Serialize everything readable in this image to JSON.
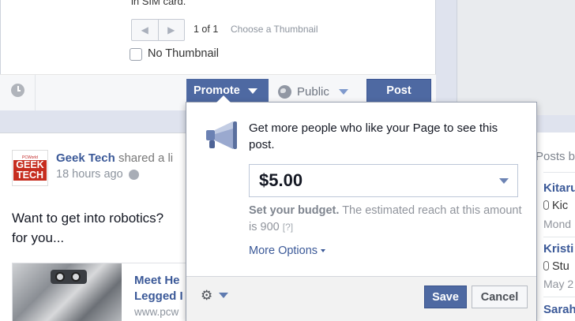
{
  "composer": {
    "attachment_text": "in SIM card.",
    "thumbnail_count": "1 of 1",
    "choose_thumbnail": "Choose a Thumbnail",
    "no_thumbnail_label": "No Thumbnail",
    "no_thumbnail_checked": false,
    "prev_icon": "chevron-left-icon",
    "next_icon": "chevron-right-icon",
    "schedule_icon": "clock-icon",
    "promote_label": "Promote",
    "audience_label": "Public",
    "post_label": "Post"
  },
  "story": {
    "page_name": "Geek Tech",
    "action_text": "shared a li",
    "logo_top_text": "PCWorld",
    "logo_text_line1": "GEEK",
    "logo_text_line2": "TECH",
    "timestamp": "18 hours ago",
    "message_line1": "Want to get into robotics?",
    "message_line2": "for you...",
    "link_title_line1": "Meet He",
    "link_title_line2": "Legged I",
    "link_url": "www.pcw"
  },
  "promote_popover": {
    "headline": "Get more people who like your Page to see this post.",
    "budget_value": "$5.00",
    "budget_help_bold": "Set your budget.",
    "budget_help_text": "The estimated reach at this amount is 900",
    "help_link": "[?]",
    "more_options": "More Options",
    "save_label": "Save",
    "cancel_label": "Cancel",
    "settings_icon": "gear-icon"
  },
  "right_rail": {
    "title": "Posts b",
    "items": [
      {
        "name": "Kitaru",
        "detail": "Kic",
        "date": "Mond"
      },
      {
        "name": "Kristi",
        "detail": "Stu",
        "date": "May 2"
      },
      {
        "name": "Sarah",
        "detail": "",
        "date": ""
      }
    ]
  },
  "colors": {
    "brand_blue": "#4e69a2",
    "link_blue": "#3b5998",
    "page_background": "#dfe3ee"
  }
}
